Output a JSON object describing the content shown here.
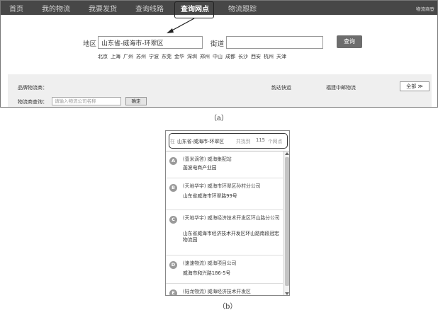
{
  "nav": {
    "items": [
      "首页",
      "我的物流",
      "我要发货",
      "查询线路",
      "查询网点",
      "物流跟踪"
    ],
    "active": "查询网点",
    "right_text": "物流商登"
  },
  "search": {
    "area_label": "地区",
    "area_value": "山东省-威海市-环翠区",
    "street_label": "街道",
    "street_value": "",
    "button": "查询",
    "cities": [
      "北京",
      "上海",
      "广州",
      "苏州",
      "宁波",
      "东莞",
      "金华",
      "深圳",
      "郑州",
      "中山",
      "成都",
      "长沙",
      "西安",
      "杭州",
      "天津"
    ]
  },
  "filter": {
    "brand_label": "品牌物流商：",
    "provider_query_label": "物流商查询：",
    "company_placeholder": "请输入物流公司名称",
    "confirm": "确定",
    "brands": [
      "韵达快运",
      "福建中邮物流"
    ],
    "all_button": "全部 ≫"
  },
  "captions": {
    "a": "（a）",
    "b": "（b）"
  },
  "results": {
    "prefix": "在",
    "location": "山东省-威海市-环翠区",
    "found_label": "共找到",
    "count": "115",
    "unit": "个网点",
    "items": [
      {
        "marker": "A",
        "name": "(壹米滴答) 威海集配站",
        "address": "菡波电商产业园"
      },
      {
        "marker": "B",
        "name": "(天地华宇) 威海市环翠区孙村分公司",
        "address": "山东省威海市环翠路99号"
      },
      {
        "marker": "C",
        "name": "(天地华宇) 威海经济技术开发区环山路分公司",
        "address": "山东省威海市经济技术开发区环山路南段冠宏物流园"
      },
      {
        "marker": "D",
        "name": "(速速物流) 威海项目公司",
        "address": "威海市和兴路186-5号"
      },
      {
        "marker": "E",
        "name": "(陆龙物流) 威海经济技术开发区",
        "address": ""
      }
    ]
  }
}
